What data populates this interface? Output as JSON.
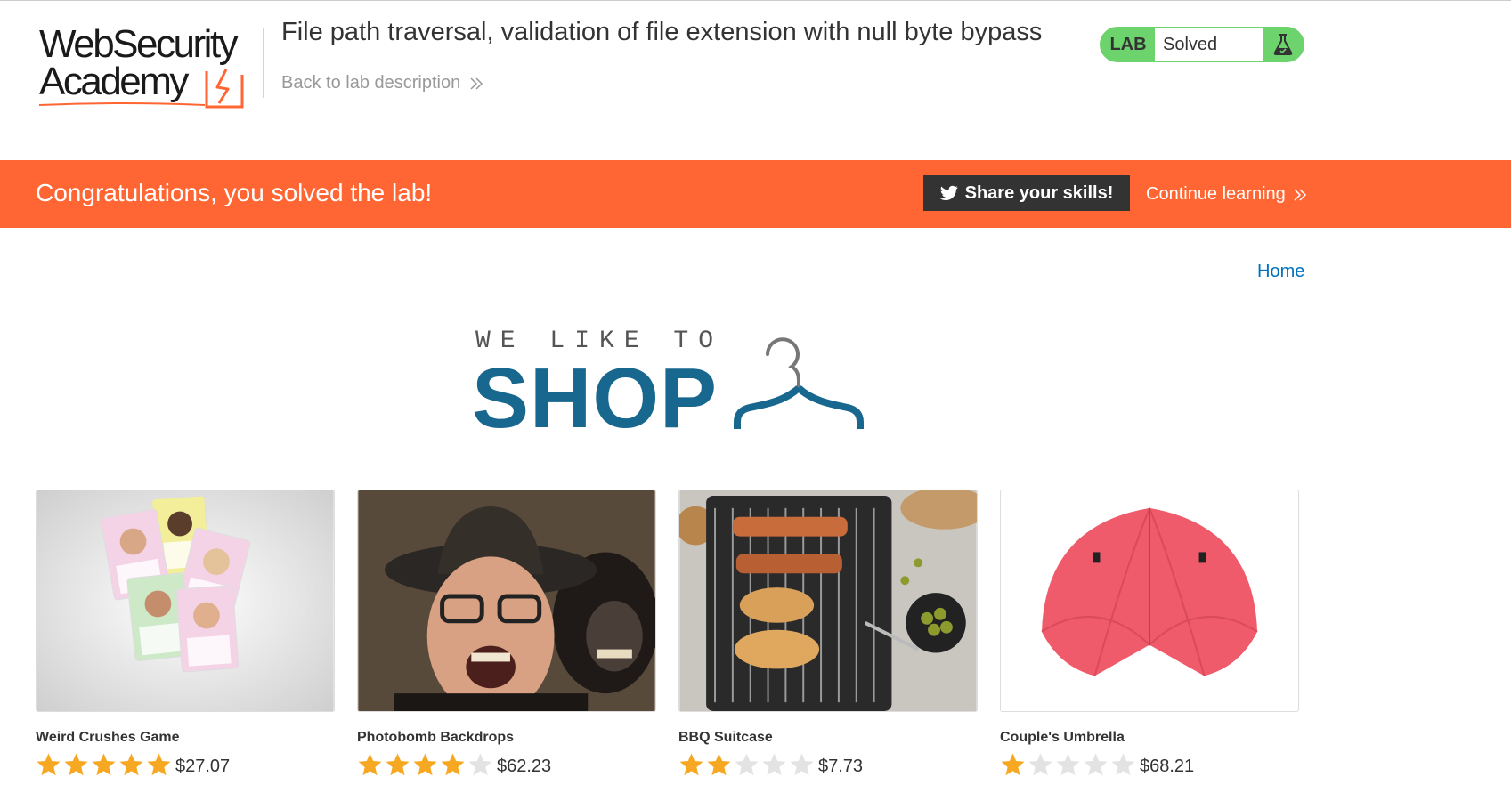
{
  "header": {
    "logo_line1": "WebSecurity",
    "logo_line2": "Academy",
    "lab_title": "File path traversal, validation of file extension with null byte bypass",
    "back_link": "Back to lab description",
    "lab_badge": {
      "label": "LAB",
      "status": "Solved",
      "icon": "flask-icon"
    }
  },
  "banner": {
    "message": "Congratulations, you solved the lab!",
    "share_button": "Share your skills!",
    "share_icon": "twitter-icon",
    "continue_link": "Continue learning"
  },
  "nav": {
    "home": "Home"
  },
  "shop_title": {
    "tagline": "WE LIKE TO",
    "main": "SHOP",
    "icon": "hanger-icon"
  },
  "products": [
    {
      "name": "Weird Crushes Game",
      "rating": 5,
      "max_rating": 5,
      "price": "$27.07",
      "image": "cards-photo"
    },
    {
      "name": "Photobomb Backdrops",
      "rating": 4,
      "max_rating": 5,
      "price": "$62.23",
      "image": "monkey-photo"
    },
    {
      "name": "BBQ Suitcase",
      "rating": 2,
      "max_rating": 5,
      "price": "$7.73",
      "image": "bbq-photo"
    },
    {
      "name": "Couple's Umbrella",
      "rating": 1,
      "max_rating": 5,
      "price": "$68.21",
      "image": "umbrella-photo"
    }
  ],
  "colors": {
    "brand_orange": "#ff6633",
    "lab_green": "#6dd36d",
    "link_blue": "#0071bc",
    "shop_blue": "#17678f",
    "star_gold": "#f7a823",
    "star_empty": "#e3e3e3"
  }
}
